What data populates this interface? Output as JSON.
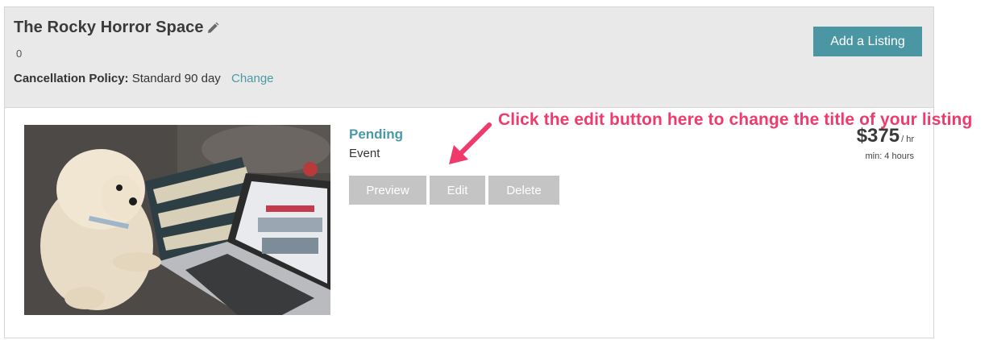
{
  "space": {
    "title": "The Rocky Horror Space",
    "count": "0",
    "policy_label": "Cancellation Policy:",
    "policy_value": "Standard 90 day",
    "change_link": "Change",
    "add_listing": "Add a Listing"
  },
  "listing": {
    "status": "Pending",
    "type": "Event",
    "price": "$375",
    "price_unit": "/ hr",
    "min": "min: 4 hours",
    "actions": {
      "preview": "Preview",
      "edit": "Edit",
      "delete": "Delete"
    }
  },
  "annotation": {
    "text": "Click the edit button here to change the title of your listing",
    "color": "#ef3a6b"
  },
  "colors": {
    "accent": "#4a97a3",
    "header_bg": "#e9e9e9",
    "button_gray": "#c4c4c4"
  },
  "icons": {
    "edit_title": "pencil-icon",
    "annotation": "arrow-icon"
  }
}
